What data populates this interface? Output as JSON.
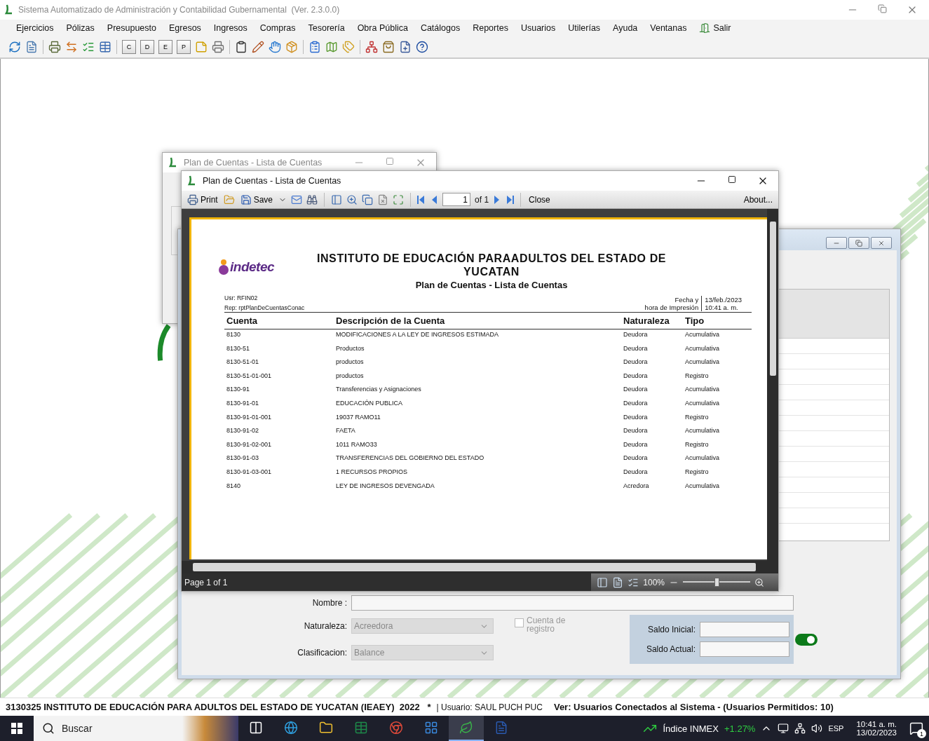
{
  "app": {
    "title": "Sistema Automatizado de Administración y Contabilidad Gubernamental  (Ver. 2.3.0.0)"
  },
  "menu": [
    {
      "label": "Ejercicios",
      "kind": "text"
    },
    {
      "label": "Pólizas",
      "kind": "text"
    },
    {
      "label": "Presupuesto",
      "kind": "text"
    },
    {
      "label": "Egresos",
      "kind": "text"
    },
    {
      "label": "Ingresos",
      "kind": "text"
    },
    {
      "label": "Compras",
      "kind": "text"
    },
    {
      "label": "Tesorería",
      "kind": "text"
    },
    {
      "label": "Obra Pública",
      "kind": "text"
    },
    {
      "label": "Catálogos",
      "kind": "text"
    },
    {
      "label": "Reportes",
      "kind": "text"
    },
    {
      "label": "Usuarios",
      "kind": "text"
    },
    {
      "label": "Utilerías",
      "kind": "text"
    },
    {
      "label": "Ayuda",
      "kind": "text"
    },
    {
      "label": "Ventanas",
      "kind": "text"
    },
    {
      "label": "Salir",
      "kind": "exit"
    }
  ],
  "toolbar": [
    {
      "kind": "icon"
    },
    {
      "kind": "icon"
    },
    {
      "kind": "separator"
    },
    {
      "kind": "icon"
    },
    {
      "kind": "icon"
    },
    {
      "kind": "icon"
    },
    {
      "kind": "icon"
    },
    {
      "kind": "separator"
    },
    {
      "kind": "letter",
      "label": "C"
    },
    {
      "kind": "letter",
      "label": "D"
    },
    {
      "kind": "letter",
      "label": "E"
    },
    {
      "kind": "letter",
      "label": "P"
    },
    {
      "kind": "icon"
    },
    {
      "kind": "icon"
    },
    {
      "kind": "separator"
    },
    {
      "kind": "icon"
    },
    {
      "kind": "icon"
    },
    {
      "kind": "icon"
    },
    {
      "kind": "icon"
    },
    {
      "kind": "separator"
    },
    {
      "kind": "icon"
    },
    {
      "kind": "icon"
    },
    {
      "kind": "icon"
    },
    {
      "kind": "separator"
    },
    {
      "kind": "icon"
    },
    {
      "kind": "icon"
    },
    {
      "kind": "icon"
    },
    {
      "kind": "icon"
    }
  ],
  "back_window": {
    "title": "Plan de Cuentas - Lista de Cuentas"
  },
  "form": {
    "nombre_label": "Nombre :",
    "naturaleza_label": "Naturaleza:",
    "naturaleza_value": "Acreedora",
    "clasificacion_label": "Clasificacion:",
    "clasificacion_value": "Balance",
    "selects_disabled": true,
    "checkbox": {
      "label": "Cuenta de registro",
      "checked": false,
      "disabled": true
    },
    "saldo_inicial_label": "Saldo Inicial:",
    "saldo_actual_label": "Saldo Actual:",
    "toggle_on": true
  },
  "viewer": {
    "title": "Plan de Cuentas - Lista de Cuentas",
    "toolbar": {
      "print": "Print",
      "save": "Save",
      "page": "1",
      "of": "of 1",
      "close": "Close",
      "about": "About..."
    },
    "report": {
      "logo": "indetec",
      "title": "INSTITUTO DE EDUCACIÓN PARAADULTOS DEL ESTADO DE YUCATAN",
      "subtitle": "Plan de Cuentas - Lista de Cuentas",
      "usr": "Usr: RFIN02",
      "rep": "Rep: rptPlanDeCuentasConac",
      "fecha_label_1": "Fecha y",
      "fecha_label_2": "hora de Impresión",
      "fecha": "13/feb./2023",
      "hora": "10:41 a. m.",
      "columns": [
        "Cuenta",
        "Descripción de la Cuenta",
        "Naturaleza",
        "Tipo"
      ],
      "rows": [
        [
          "8130",
          "MODIFICACIONES A LA LEY DE INGRESOS ESTIMADA",
          "Deudora",
          "Acumulativa"
        ],
        [
          "8130-51",
          "Productos",
          "Deudora",
          "Acumulativa"
        ],
        [
          "8130-51-01",
          "productos",
          "Deudora",
          "Acumulativa"
        ],
        [
          "8130-51-01-001",
          "productos",
          "Deudora",
          "Registro"
        ],
        [
          "8130-91",
          "Transferencias y Asignaciones",
          "Deudora",
          "Acumulativa"
        ],
        [
          "8130-91-01",
          "EDUCACIÓN PUBLICA",
          "Deudora",
          "Acumulativa"
        ],
        [
          "8130-91-01-001",
          "19037 RAMO11",
          "Deudora",
          "Registro"
        ],
        [
          "8130-91-02",
          "FAETA",
          "Deudora",
          "Acumulativa"
        ],
        [
          "8130-91-02-001",
          "1011 RAMO33",
          "Deudora",
          "Registro"
        ],
        [
          "8130-91-03",
          "TRANSFERENCIAS DEL GOBIERNO DEL ESTADO",
          "Deudora",
          "Acumulativa"
        ],
        [
          "8130-91-03-001",
          "1 RECURSOS PROPIOS",
          "Deudora",
          "Registro"
        ],
        [
          "8140",
          "LEY DE INGRESOS DEVENGADA",
          "Acredora",
          "Acumulativa"
        ]
      ]
    },
    "footer": {
      "page": "Page 1 of 1",
      "zoom": "100%",
      "level": 0.5
    }
  },
  "status_bar": {
    "entity": "3130325 INSTITUTO DE EDUCACIÓN PARA ADULTOS DEL ESTADO DE YUCATAN (IEAEY)  2022   *",
    "user": "| Usuario: SAUL PUCH PUC",
    "connected": "Ver: Usuarios Conectados al Sistema - (Usuarios Permitidos: 10)"
  },
  "taskbar": {
    "search_placeholder": "Buscar",
    "apps": [
      {
        "selected": false
      },
      {
        "selected": false
      },
      {
        "selected": false
      },
      {
        "selected": false
      },
      {
        "selected": false
      },
      {
        "selected": false
      },
      {
        "selected": true
      },
      {
        "selected": false
      }
    ],
    "index_name": "Índice INMEX",
    "index_change": "+1.27%",
    "language": "ESP",
    "time": "10:41 a. m.",
    "date": "13/02/2023",
    "notifications": "1"
  }
}
